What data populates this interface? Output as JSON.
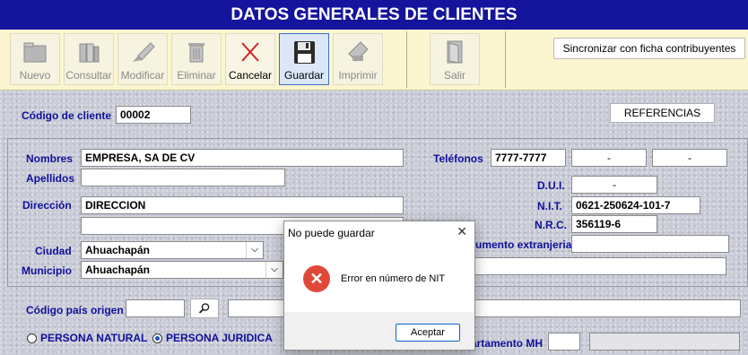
{
  "window": {
    "title": "DATOS GENERALES DE CLIENTES"
  },
  "toolbar": {
    "buttons": [
      {
        "label": "Nuevo",
        "icon": "folder-icon",
        "enabled": false
      },
      {
        "label": "Consultar",
        "icon": "books-icon",
        "enabled": false
      },
      {
        "label": "Modificar",
        "icon": "pen-icon",
        "enabled": false
      },
      {
        "label": "Eliminar",
        "icon": "trash-icon",
        "enabled": false
      },
      {
        "label": "Cancelar",
        "icon": "cancel-x-icon",
        "enabled": true
      },
      {
        "label": "Guardar",
        "icon": "floppy-disk-icon",
        "enabled": true
      },
      {
        "label": "Imprimir",
        "icon": "printer-icon",
        "enabled": false
      },
      {
        "label": "Salir",
        "icon": "door-exit-icon",
        "enabled": false
      }
    ],
    "sync_label": "Sincronizar con ficha contribuyentes"
  },
  "form": {
    "codigo_label": "Código de cliente",
    "codigo_value": "00002",
    "referencias_label": "REFERENCIAS",
    "nombres_label": "Nombres",
    "nombres_value": "EMPRESA, SA DE CV",
    "apellidos_label": "Apellidos",
    "apellidos_value": "",
    "direccion_label": "Dirección",
    "direccion_value": "DIRECCION",
    "direccion_value2": "",
    "ciudad_label": "Ciudad",
    "ciudad_value": "Ahuachapán",
    "municipio_label": "Municipio",
    "municipio_value": "Ahuachapán",
    "telefonos_label": "Teléfonos",
    "telefono1": "7777-7777",
    "telefono2": "-",
    "telefono3": "-",
    "dui_label": "D.U.I.",
    "dui_value": "-",
    "nit_label": "N.I.T.",
    "nit_value": "0621-250624-101-7",
    "nrc_label": "N.R.C.",
    "nrc_value": "356119-6",
    "doc_extranjero_label": "umento extranjeria",
    "doc_extranjero_value": "",
    "extra_value": "",
    "pais_label": "Código país origen",
    "pais_value": "",
    "pais_nombre": "",
    "persona_natural_label": "PERSONA NATURAL",
    "persona_juridica_label": "PERSONA JURIDICA",
    "persona_selected": "juridica",
    "departamento_label": "artamento MH",
    "departamento_value": "",
    "departamento_nombre": ""
  },
  "dialog": {
    "title": "No puede guardar",
    "close_glyph": "✕",
    "icon": "error-circle-icon",
    "message": "Error en número de NIT",
    "ok_label": "Aceptar"
  },
  "colors": {
    "title_bar": "#14149c",
    "toolbar_bg": "#fbf6cf",
    "label_blue": "#10109a",
    "error_red": "#e0493a",
    "dialog_accent": "#0a64d2"
  }
}
